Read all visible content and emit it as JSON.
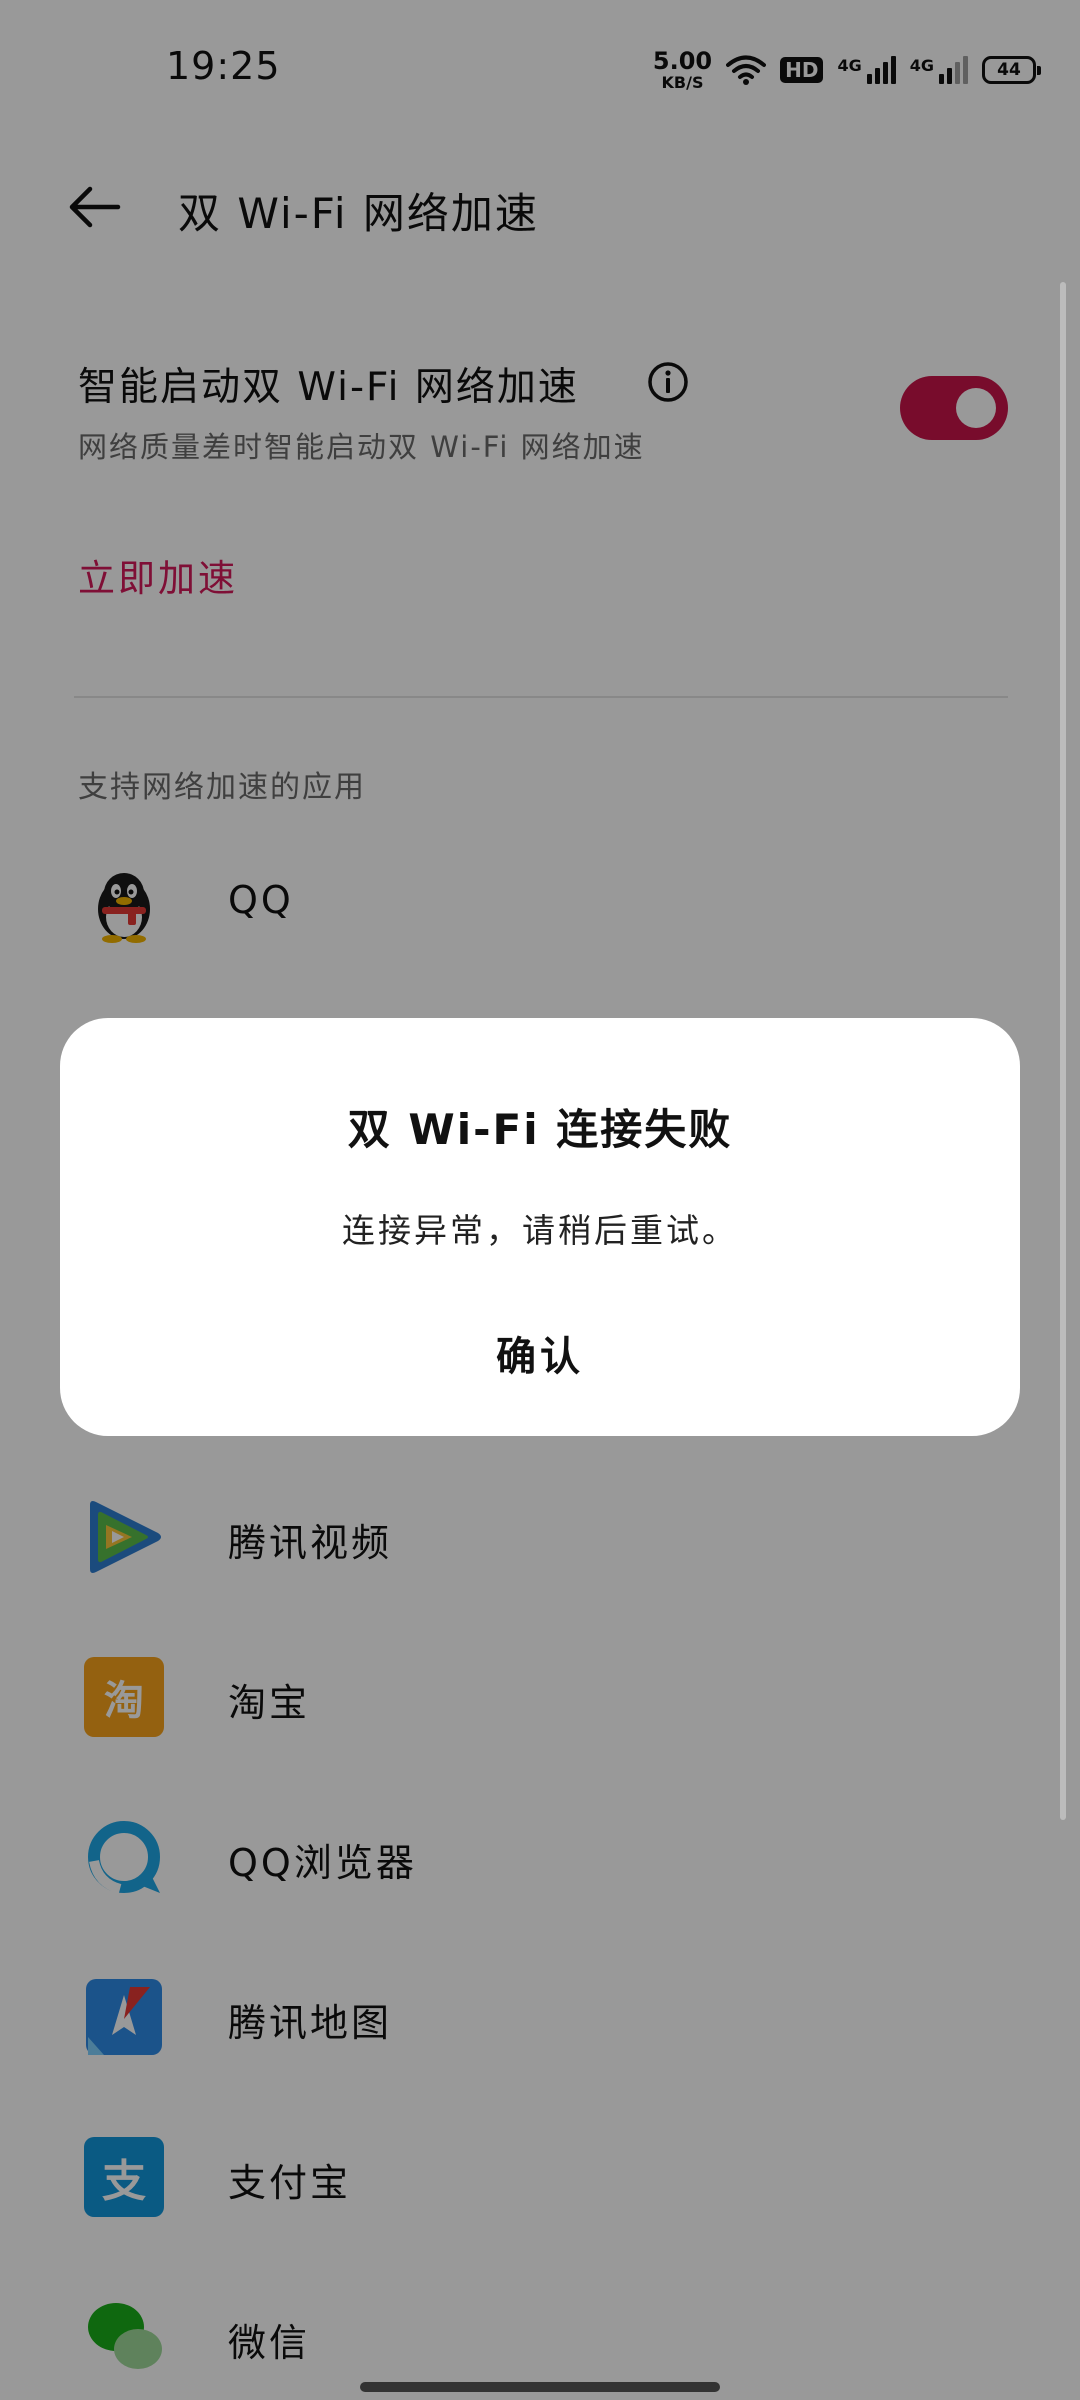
{
  "status_bar": {
    "time": "19:25",
    "net_speed_value": "5.00",
    "net_speed_unit": "KB/S",
    "hd_badge": "HD",
    "signal1_label": "4G",
    "signal2_label": "4G",
    "battery": "44"
  },
  "header": {
    "title": "双 Wi-Fi 网络加速"
  },
  "smart_accel": {
    "title": "智能启动双 Wi-Fi 网络加速",
    "subtitle": "网络质量差时智能启动双 Wi-Fi 网络加速",
    "enabled": true
  },
  "accelerate_now": "立即加速",
  "section_label": "支持网络加速的应用",
  "apps": [
    {
      "name": "QQ",
      "icon": "qq-penguin-icon"
    },
    {
      "name": "腾讯视频",
      "icon": "tencent-video-icon"
    },
    {
      "name": "淘宝",
      "icon": "taobao-icon",
      "glyph": "淘"
    },
    {
      "name": "QQ浏览器",
      "icon": "qq-browser-icon"
    },
    {
      "name": "腾讯地图",
      "icon": "tencent-map-icon"
    },
    {
      "name": "支付宝",
      "icon": "alipay-icon",
      "glyph": "支"
    },
    {
      "name": "微信",
      "icon": "wechat-icon"
    }
  ],
  "dialog": {
    "title": "双 Wi-Fi 连接失败",
    "message": "连接异常，请稍后重试。",
    "confirm": "确认"
  },
  "colors": {
    "accent": "#d4195a",
    "toggle_on": "#c8154a"
  }
}
